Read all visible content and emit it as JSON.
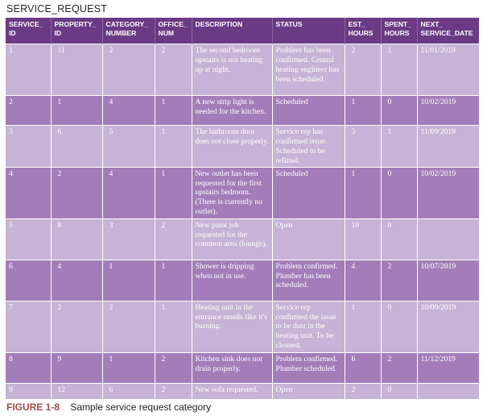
{
  "table_title": "SERVICE_REQUEST",
  "columns": [
    "SERVICE_ ID",
    "PROPERTY_ ID",
    "CATEGORY_ NUMBER",
    "OFFICE_ NUM",
    "DESCRIPTION",
    "STATUS",
    "EST_ HOURS",
    "SPENT_ HOURS",
    "NEXT_ SERVICE_DATE"
  ],
  "rows": [
    [
      "1",
      "11",
      "2",
      "2",
      "The second bedroom upstairs is not heating up at night.",
      "Problem has been confirmed. Central heating engineer has been scheduled.",
      "2",
      "1",
      "11/01/2019"
    ],
    [
      "2",
      "1",
      "4",
      "1",
      "A new strip light is needed for the kitchen.",
      "Scheduled",
      "1",
      "0",
      "10/02/2019"
    ],
    [
      "3",
      "6",
      "5",
      "1",
      "The bathroom door does not close properly.",
      "Service rep has confirmed issue. Scheduled to be refitted.",
      "3",
      "1",
      "11/09/2019"
    ],
    [
      "4",
      "2",
      "4",
      "1",
      "New outlet has been requested for the first upstairs bedroom. (There is currently no outlet).",
      "Scheduled",
      "1",
      "0",
      "10/02/2019"
    ],
    [
      "5",
      "8",
      "3",
      "2",
      "New paint job requested for the common area (lounge).",
      "Open",
      "10",
      "0",
      ""
    ],
    [
      "6",
      "4",
      "1",
      "1",
      "Shower is dripping when not in use.",
      "Problem confirmed. Plumber has been scheduled.",
      "4",
      "2",
      "10/07/2019"
    ],
    [
      "7",
      "2",
      "2",
      "1",
      "Heating unit in the entrance smells like it's burning.",
      "Service rep confirmed the issue to be dust in the heating unit. To be cleaned.",
      "1",
      "0",
      "10/09/2019"
    ],
    [
      "8",
      "9",
      "1",
      "2",
      "Kitchen sink does not drain properly.",
      "Problem confirmed. Plumber scheduled.",
      "6",
      "2",
      "11/12/2019"
    ],
    [
      "9",
      "12",
      "6",
      "2",
      "New sofa requested.",
      "Open",
      "2",
      "0",
      ""
    ]
  ],
  "caption": {
    "figure_label": "FIGURE 1-8",
    "text": "Sample service request category"
  },
  "colors": {
    "header_bg": "#6b3a84",
    "row_light": "#c7b3d5",
    "row_dark": "#a37db9",
    "caption_label": "#a64a4a"
  }
}
